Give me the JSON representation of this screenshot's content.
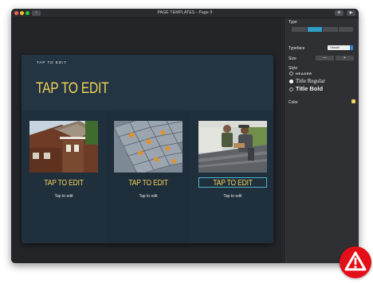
{
  "window": {
    "title": "PAGE TEMPLATES - Page 9"
  },
  "toolbar": {
    "back_label": "‹",
    "gear_label": "⚙",
    "play_label": "▶"
  },
  "card": {
    "small_title": "TAP TO EDIT",
    "big_title": "TAP TO EDIT",
    "columns": [
      {
        "title": "TAP TO EDIT",
        "text": "Tap to edit"
      },
      {
        "title": "TAP TO EDIT",
        "text": "Tap to edit"
      },
      {
        "title": "TAP TO EDIT",
        "text": "Tap to edit"
      }
    ]
  },
  "sidebar": {
    "type_label": "Type",
    "typeface_label": "Typeface",
    "typeface_value": "Oswald",
    "size_label": "Size",
    "size_minus": "—",
    "size_plus": "+",
    "style_label": "Style",
    "styles": [
      "HEADER",
      "Title Regular",
      "Title Bold"
    ],
    "color_label": "Color"
  },
  "colors": {
    "accent_text": "#f2d25a",
    "selection": "#2f9ec6",
    "alert": "#e30e17"
  }
}
